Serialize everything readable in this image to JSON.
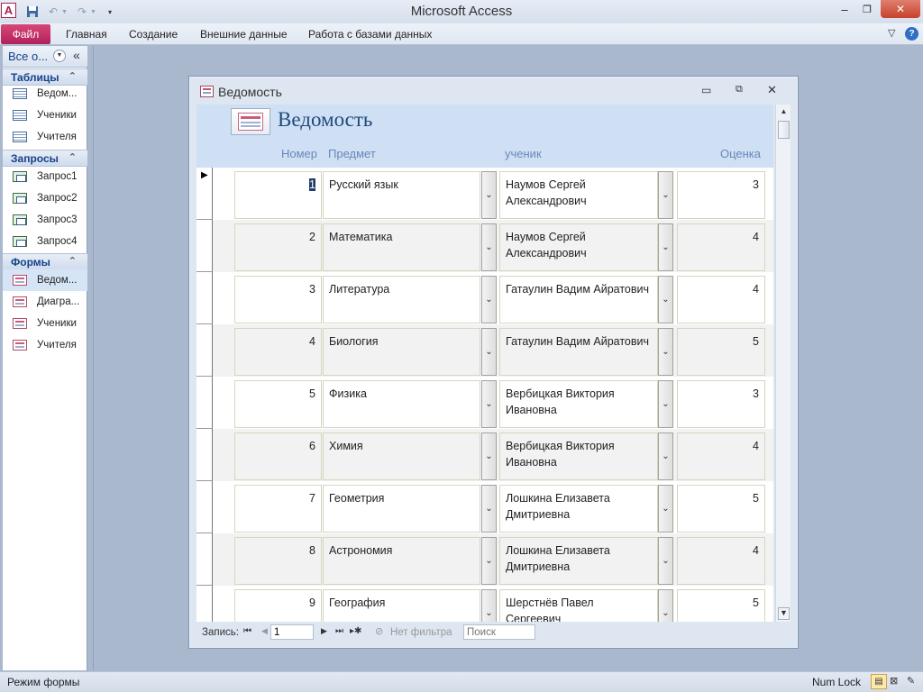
{
  "window": {
    "title": "Microsoft Access"
  },
  "ribbon": {
    "file_tab": "Файл",
    "tabs": [
      "Главная",
      "Создание",
      "Внешние данные",
      "Работа с базами данных"
    ]
  },
  "nav": {
    "header": "Все о...",
    "groups": [
      {
        "title": "Таблицы",
        "items": [
          {
            "label": "Ведом...",
            "icon": "table-icon"
          },
          {
            "label": "Ученики",
            "icon": "table-icon"
          },
          {
            "label": "Учителя",
            "icon": "table-icon"
          }
        ]
      },
      {
        "title": "Запросы",
        "items": [
          {
            "label": "Запрос1",
            "icon": "query-icon"
          },
          {
            "label": "Запрос2",
            "icon": "query-icon"
          },
          {
            "label": "Запрос3",
            "icon": "query-icon"
          },
          {
            "label": "Запрос4",
            "icon": "query-icon"
          }
        ]
      },
      {
        "title": "Формы",
        "items": [
          {
            "label": "Ведом...",
            "icon": "form-icon",
            "selected": true
          },
          {
            "label": "Диагра...",
            "icon": "form-icon"
          },
          {
            "label": "Ученики",
            "icon": "form-icon"
          },
          {
            "label": "Учителя",
            "icon": "form-icon"
          }
        ]
      }
    ]
  },
  "form": {
    "window_title": "Ведомость",
    "header_title": "Ведомость",
    "columns": [
      "Номер",
      "Предмет",
      "ученик",
      "Оценка"
    ],
    "rows": [
      {
        "num": "1",
        "subject": "Русский язык",
        "student": "Наумов Сергей Александрович",
        "grade": "3"
      },
      {
        "num": "2",
        "subject": "Математика",
        "student": "Наумов Сергей Александрович",
        "grade": "4"
      },
      {
        "num": "3",
        "subject": "Литература",
        "student": "Гатаулин Вадим Айратович",
        "grade": "4"
      },
      {
        "num": "4",
        "subject": "Биология",
        "student": "Гатаулин Вадим Айратович",
        "grade": "5"
      },
      {
        "num": "5",
        "subject": "Физика",
        "student": "Вербицкая Виктория Ивановна",
        "grade": "3"
      },
      {
        "num": "6",
        "subject": "Химия",
        "student": "Вербицкая Виктория Ивановна",
        "grade": "4"
      },
      {
        "num": "7",
        "subject": "Геометрия",
        "student": "Лошкина Елизавета Дмитриевна",
        "grade": "5"
      },
      {
        "num": "8",
        "subject": "Астрономия",
        "student": "Лошкина Елизавета Дмитриевна",
        "grade": "4"
      },
      {
        "num": "9",
        "subject": "География",
        "student": "Шерстнёв Павел Сергеевич",
        "grade": "5"
      }
    ],
    "record_nav": {
      "label": "Запись:",
      "current": "1",
      "filter": "Нет фильтра",
      "search_placeholder": "Поиск"
    }
  },
  "status": {
    "left": "Режим формы",
    "num_lock": "Num Lock"
  },
  "colors": {
    "file_tab": "#c0285f",
    "header_bg": "#cfe0f4",
    "header_label": "#6987b8",
    "header_title": "#1f497d"
  }
}
